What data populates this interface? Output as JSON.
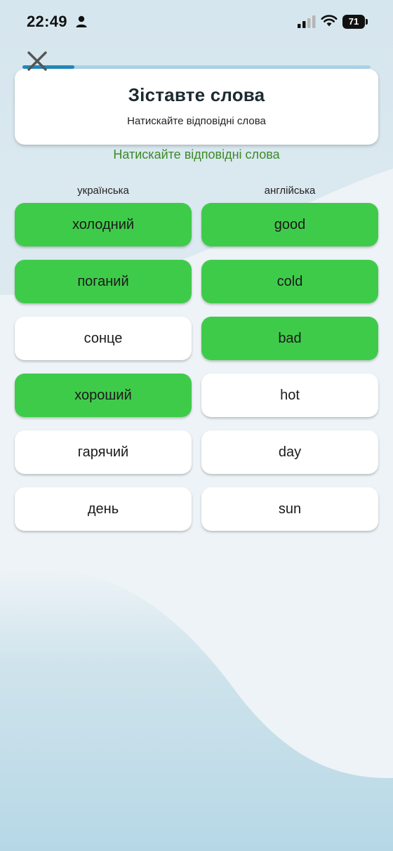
{
  "status_bar": {
    "time": "22:49",
    "battery": "71",
    "icons": [
      "person-icon",
      "cellular-signal-icon",
      "wifi-icon",
      "battery-icon"
    ]
  },
  "close_icon": "close-icon",
  "progress": {
    "fraction": 0.15
  },
  "header": {
    "title": "Зіставте слова",
    "subtitle": "Натискайте відповідні слова"
  },
  "instruction": "Натискайте відповідні слова",
  "columns": {
    "left_label": "українська",
    "right_label": "англійська"
  },
  "ukrainian_words": [
    {
      "text": "холодний",
      "matched": true
    },
    {
      "text": "поганий",
      "matched": true
    },
    {
      "text": "сонце",
      "matched": false
    },
    {
      "text": "хороший",
      "matched": true
    },
    {
      "text": "гарячий",
      "matched": false
    },
    {
      "text": "день",
      "matched": false
    }
  ],
  "english_words": [
    {
      "text": "good",
      "matched": true
    },
    {
      "text": "cold",
      "matched": true
    },
    {
      "text": "bad",
      "matched": true
    },
    {
      "text": "hot",
      "matched": false
    },
    {
      "text": "day",
      "matched": false
    },
    {
      "text": "sun",
      "matched": false
    }
  ],
  "colors": {
    "matched": "#3fcb4a",
    "unmatched": "#ffffff",
    "instruction": "#3c8a28",
    "progress_fill": "#2089bb",
    "progress_track": "#a9d3e8"
  }
}
